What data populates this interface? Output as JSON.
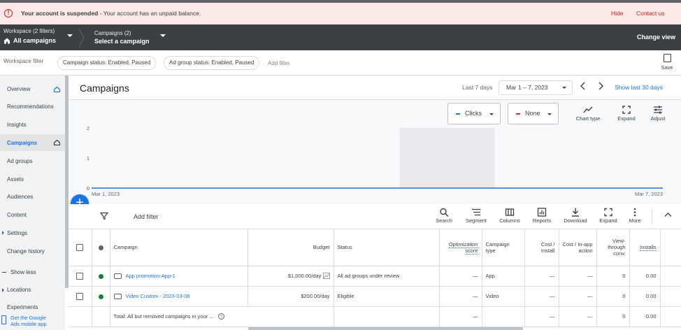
{
  "banner": {
    "title": "Your account is suspended",
    "message": " - Your account has an unpaid balance.",
    "hide": "Hide",
    "contact": "Contact us"
  },
  "workspace": {
    "filters_label": "Workspace (2 filters)",
    "all_campaigns": "All campaigns",
    "campaigns_count": "Campaigns (2)",
    "select_campaign": "Select a campaign",
    "change_view": "Change view"
  },
  "filterbar": {
    "label": "Workspace filter",
    "chips": [
      "Campaign status: Enabled, Paused",
      "Ad group status: Enabled, Paused"
    ],
    "add_filter": "Add filter",
    "save": "Save"
  },
  "sidebar": {
    "items": [
      {
        "label": "Overview"
      },
      {
        "label": "Recommendations"
      },
      {
        "label": "Insights"
      },
      {
        "label": "Campaigns"
      },
      {
        "label": "Ad groups"
      },
      {
        "label": "Assets"
      },
      {
        "label": "Audiences"
      },
      {
        "label": "Content"
      },
      {
        "label": "Settings"
      },
      {
        "label": "Change history"
      },
      {
        "label": "Show less"
      },
      {
        "label": "Locations"
      },
      {
        "label": "Experiments"
      }
    ],
    "get_app": [
      "Get the Google",
      "Ads mobile app"
    ]
  },
  "header": {
    "title": "Campaigns",
    "period": "Last 7 days",
    "date_range": "Mar 1 – 7, 2023",
    "show_last": "Show last 30 days"
  },
  "chart_controls": {
    "metric1": "Clicks",
    "metric2": "None",
    "chart_type": "Chart type",
    "expand": "Expand",
    "adjust": "Adjust",
    "metric1_color": "#1a73e8",
    "metric2_color": "#d93025"
  },
  "chart_data": {
    "type": "line",
    "x": [
      "2023-03-01",
      "2023-03-02",
      "2023-03-03",
      "2023-03-04",
      "2023-03-05",
      "2023-03-06",
      "2023-03-07"
    ],
    "series": [
      {
        "name": "Clicks",
        "values": [
          0,
          0,
          0,
          0,
          0,
          0,
          0
        ]
      }
    ],
    "x_tick_labels": [
      "Mar 1, 2023",
      "Mar 7, 2023"
    ],
    "y_ticks": [
      0,
      1,
      2
    ],
    "ylim": [
      0,
      2
    ],
    "highlight_x": [
      "2023-03-04",
      "2023-03-05"
    ]
  },
  "toolbar": {
    "add_filter": "Add filter",
    "buttons": [
      "Search",
      "Segment",
      "Columns",
      "Reports",
      "Download",
      "Expand",
      "More"
    ]
  },
  "table": {
    "headers": [
      "Campaign",
      "Budget",
      "Status",
      "Optimization score",
      "Campaign type",
      "Cost / Install",
      "Cost / In-app action",
      "View-through conv.",
      "Installs"
    ],
    "rows": [
      {
        "name": "App promotion-App-1",
        "budget": "$1,000.00/day",
        "status": "All ad groups under review",
        "opt": "—",
        "type": "App",
        "cost_install": "—",
        "cost_inapp": "—",
        "vtc": "0",
        "installs": "0.00"
      },
      {
        "name": "Video Custom - 2023-03-08",
        "budget": "$200.00/day",
        "status": "Eligible",
        "opt": "—",
        "type": "Video",
        "cost_install": "—",
        "cost_inapp": "—",
        "vtc": "0",
        "installs": "0.00"
      }
    ],
    "total": {
      "label": "Total: All but removed campaigns in your ...",
      "opt": "—",
      "cost_install": "—",
      "cost_inapp": "—",
      "vtc": "0",
      "installs": "0.00"
    },
    "status_color": "#188038"
  }
}
